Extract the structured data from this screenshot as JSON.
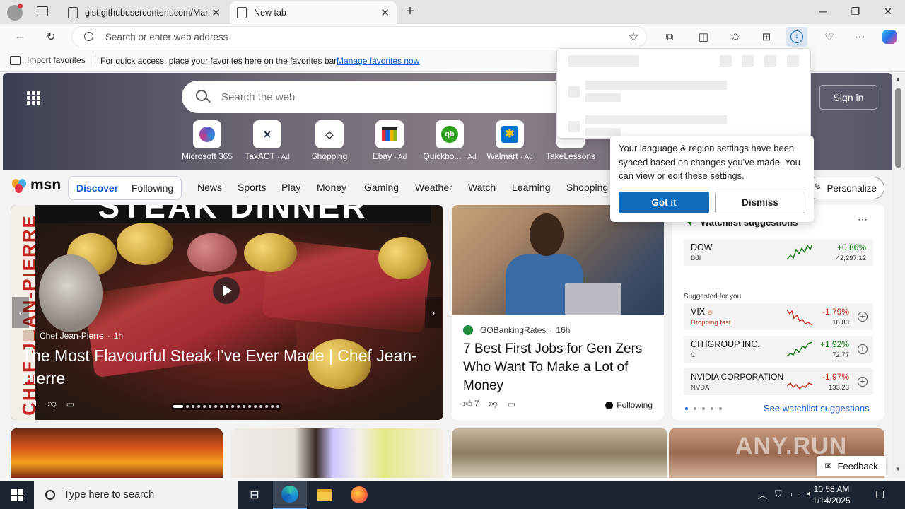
{
  "browser": {
    "tabs": [
      {
        "label": "gist.githubusercontent.com/Mar",
        "active": false
      },
      {
        "label": "New tab",
        "active": true
      }
    ],
    "address_placeholder": "Search or enter web address",
    "favorites_bar": {
      "import_label": "Import favorites",
      "message": "For quick access, place your favorites here on the favorites bar.",
      "manage_link": "Manage favorites now"
    }
  },
  "msn": {
    "search_placeholder": "Search the web",
    "sign_in": "Sign in",
    "shortcuts": [
      {
        "label": "Microsoft 365",
        "ad": ""
      },
      {
        "label": "TaxACT",
        "ad": "· Ad"
      },
      {
        "label": "Shopping",
        "ad": ""
      },
      {
        "label": "Ebay",
        "ad": "· Ad"
      },
      {
        "label": "Quickbo...",
        "ad": "· Ad"
      },
      {
        "label": "Walmart",
        "ad": "· Ad"
      },
      {
        "label": "TakeLessons",
        "ad": ""
      }
    ],
    "logo": "msn",
    "discover": "Discover",
    "following": "Following",
    "nav": [
      "News",
      "Sports",
      "Play",
      "Money",
      "Gaming",
      "Weather",
      "Watch",
      "Learning",
      "Shopping"
    ],
    "personalize": "Personalize",
    "main_story": {
      "banner": "STEAK DINNER",
      "side_text": "CHEF JEAN-PIERRE",
      "source": "Chef Jean-Pierre",
      "age": "1h",
      "headline": "The Most Flavourful Steak I've Ever Made | Chef Jean-Pierre",
      "likes": "1"
    },
    "card2": {
      "source": "GOBankingRates",
      "age": "16h",
      "headline": "7 Best First Jobs for Gen Zers Who Want To Make a Lot of Money",
      "likes": "7",
      "following": "Following"
    },
    "watchlist": {
      "title": "Watchlist suggestions",
      "suggested_label": "Suggested for you",
      "see_all": "See watchlist suggestions",
      "rows": [
        {
          "name": "DOW",
          "ticker": "DJI",
          "change": "+0.86%",
          "price": "42,297.12",
          "dir": "up"
        },
        {
          "name": "VIX",
          "ticker": "Dropping fast",
          "change": "-1.79%",
          "price": "18.83",
          "dir": "down"
        },
        {
          "name": "CITIGROUP INC.",
          "ticker": "C",
          "change": "+1.92%",
          "price": "72.77",
          "dir": "up"
        },
        {
          "name": "NVIDIA CORPORATION",
          "ticker": "NVDA",
          "change": "-1.97%",
          "price": "133.23",
          "dir": "down"
        }
      ]
    },
    "feedback": "Feedback"
  },
  "language_popup": {
    "message": "Your language & region settings have been synced based on changes you've made. You can view or edit these settings.",
    "got_it": "Got it",
    "dismiss": "Dismiss"
  },
  "watermark": "ANY.RUN",
  "taskbar": {
    "search_placeholder": "Type here to search",
    "time": "10:58 AM",
    "date": "1/14/2025"
  },
  "colors": {
    "accent": "#0f6cbd",
    "link": "#0b57d0",
    "up": "#0f7b0f",
    "down": "#c42b1c",
    "taskbar": "#1b2433"
  }
}
